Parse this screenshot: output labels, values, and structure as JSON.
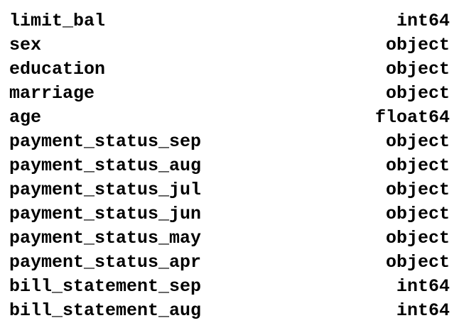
{
  "dtypes": {
    "rows": [
      {
        "name": "limit_bal",
        "dtype": "int64"
      },
      {
        "name": "sex",
        "dtype": "object"
      },
      {
        "name": "education",
        "dtype": "object"
      },
      {
        "name": "marriage",
        "dtype": "object"
      },
      {
        "name": "age",
        "dtype": "float64"
      },
      {
        "name": "payment_status_sep",
        "dtype": "object"
      },
      {
        "name": "payment_status_aug",
        "dtype": "object"
      },
      {
        "name": "payment_status_jul",
        "dtype": "object"
      },
      {
        "name": "payment_status_jun",
        "dtype": "object"
      },
      {
        "name": "payment_status_may",
        "dtype": "object"
      },
      {
        "name": "payment_status_apr",
        "dtype": "object"
      },
      {
        "name": "bill_statement_sep",
        "dtype": "int64"
      },
      {
        "name": "bill_statement_aug",
        "dtype": "int64"
      }
    ]
  }
}
